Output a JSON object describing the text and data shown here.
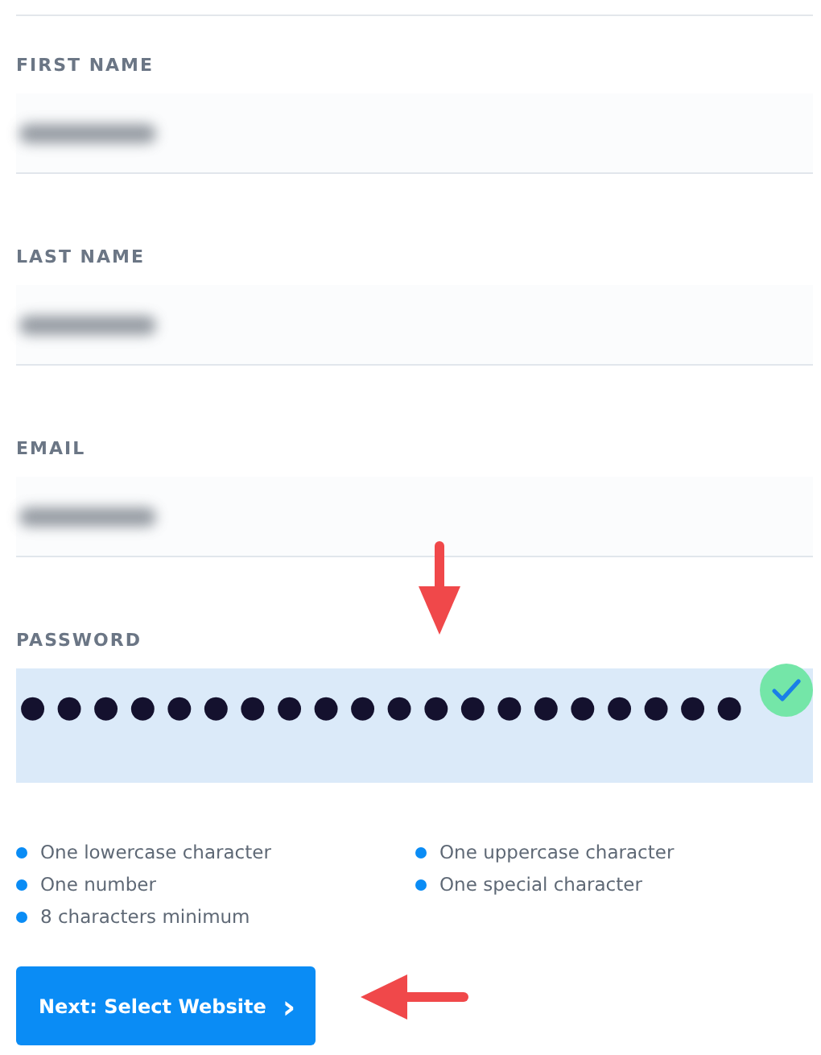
{
  "fields": [
    {
      "kind": "text",
      "label": "FIRST NAME",
      "blurred": true
    },
    {
      "kind": "text",
      "label": "LAST NAME",
      "blurred": true
    },
    {
      "kind": "text",
      "label": "EMAIL",
      "blurred": true
    },
    {
      "kind": "password",
      "label": "PASSWORD",
      "value": "●●●●●●●●●●●●●●●●●●●●",
      "valid": true,
      "focused": true
    }
  ],
  "requirements": [
    {
      "text": "One lowercase character",
      "color": "#0a8cf5"
    },
    {
      "text": "One uppercase character",
      "color": "#0a8cf5"
    },
    {
      "text": "One number",
      "color": "#0a8cf5"
    },
    {
      "text": "One special character",
      "color": "#0a8cf5"
    },
    {
      "text": "8 characters minimum",
      "color": "#0a8cf5"
    }
  ],
  "next_button": {
    "label": "Next: Select Website",
    "icon": "›"
  },
  "annotation_arrows": [
    {
      "kind": "down"
    },
    {
      "kind": "left"
    }
  ]
}
